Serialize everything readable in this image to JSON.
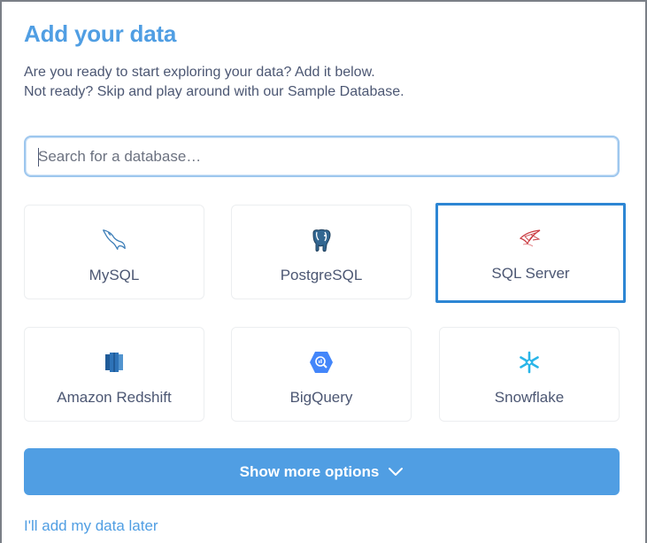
{
  "page": {
    "title": "Add your data",
    "description_line1": "Are you ready to start exploring your data? Add it below.",
    "description_line2": "Not ready? Skip and play around with our Sample Database."
  },
  "search": {
    "placeholder": "Search for a database…",
    "value": ""
  },
  "databases": [
    {
      "label": "MySQL",
      "icon": "mysql-dolphin-icon",
      "selected": false
    },
    {
      "label": "PostgreSQL",
      "icon": "postgresql-elephant-icon",
      "selected": false
    },
    {
      "label": "SQL Server",
      "icon": "sql-server-icon",
      "selected": true
    },
    {
      "label": "Amazon Redshift",
      "icon": "redshift-icon",
      "selected": false
    },
    {
      "label": "BigQuery",
      "icon": "bigquery-icon",
      "selected": false
    },
    {
      "label": "Snowflake",
      "icon": "snowflake-icon",
      "selected": false
    }
  ],
  "show_more": {
    "label": "Show more options",
    "icon": "chevron-down-icon"
  },
  "skip_link": {
    "label": "I'll add my data later"
  },
  "colors": {
    "brand": "#509ee3",
    "selected_border": "#2d86d4",
    "text": "#4c5773"
  }
}
